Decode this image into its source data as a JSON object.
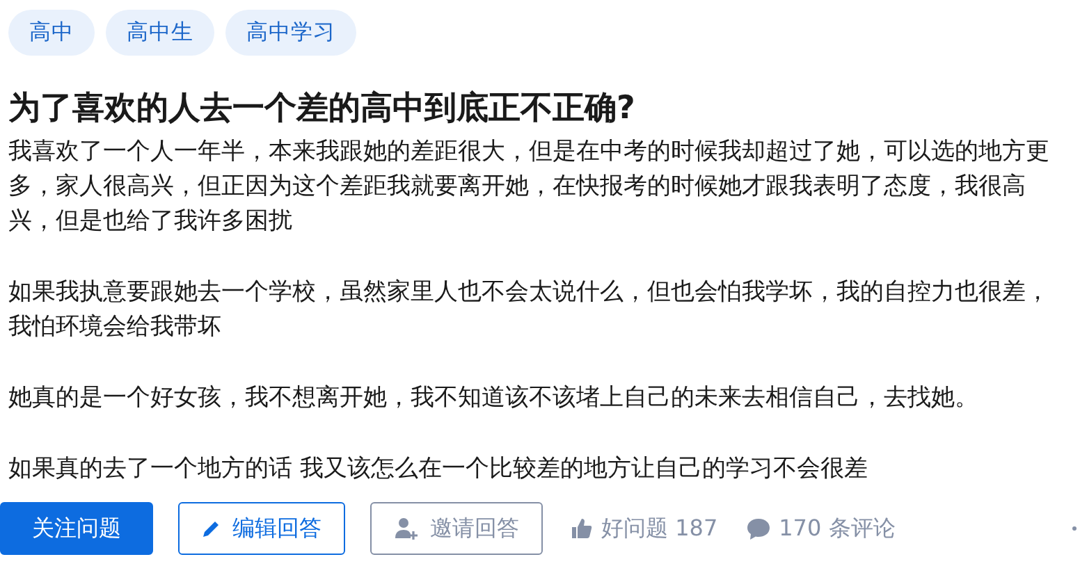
{
  "tags": [
    {
      "label": "高中"
    },
    {
      "label": "高中生"
    },
    {
      "label": "高中学习"
    }
  ],
  "question": {
    "title": "为了喜欢的人去一个差的高中到底正不正确?",
    "paragraphs": [
      "我喜欢了一个人一年半，本来我跟她的差距很大，但是在中考的时候我却超过了她，可以选的地方更多，家人很高兴，但正因为这个差距我就要离开她，在快报考的时候她才跟我表明了态度，我很高兴，但是也给了我许多困扰",
      "如果我执意要跟她去一个学校，虽然家里人也不会太说什么，但也会怕我学坏，我的自控力也很差，我怕环境会给我带坏",
      "她真的是一个好女孩，我不想离开她，我不知道该不该堵上自己的未来去相信自己，去找她。",
      "如果真的去了一个地方的话 我又该怎么在一个比较差的地方让自己的学习不会很差"
    ]
  },
  "actions": [
    {
      "kind": "primary",
      "label": "关注问题",
      "disabled": false
    },
    {
      "kind": "edit",
      "label": "编辑回答",
      "disabled": false
    },
    {
      "kind": "invite",
      "label": "邀请回答",
      "disabled": true
    }
  ],
  "stats": [
    {
      "kind": "like",
      "label": "好问题 187"
    },
    {
      "kind": "comment",
      "label": "170 条评论"
    }
  ]
}
